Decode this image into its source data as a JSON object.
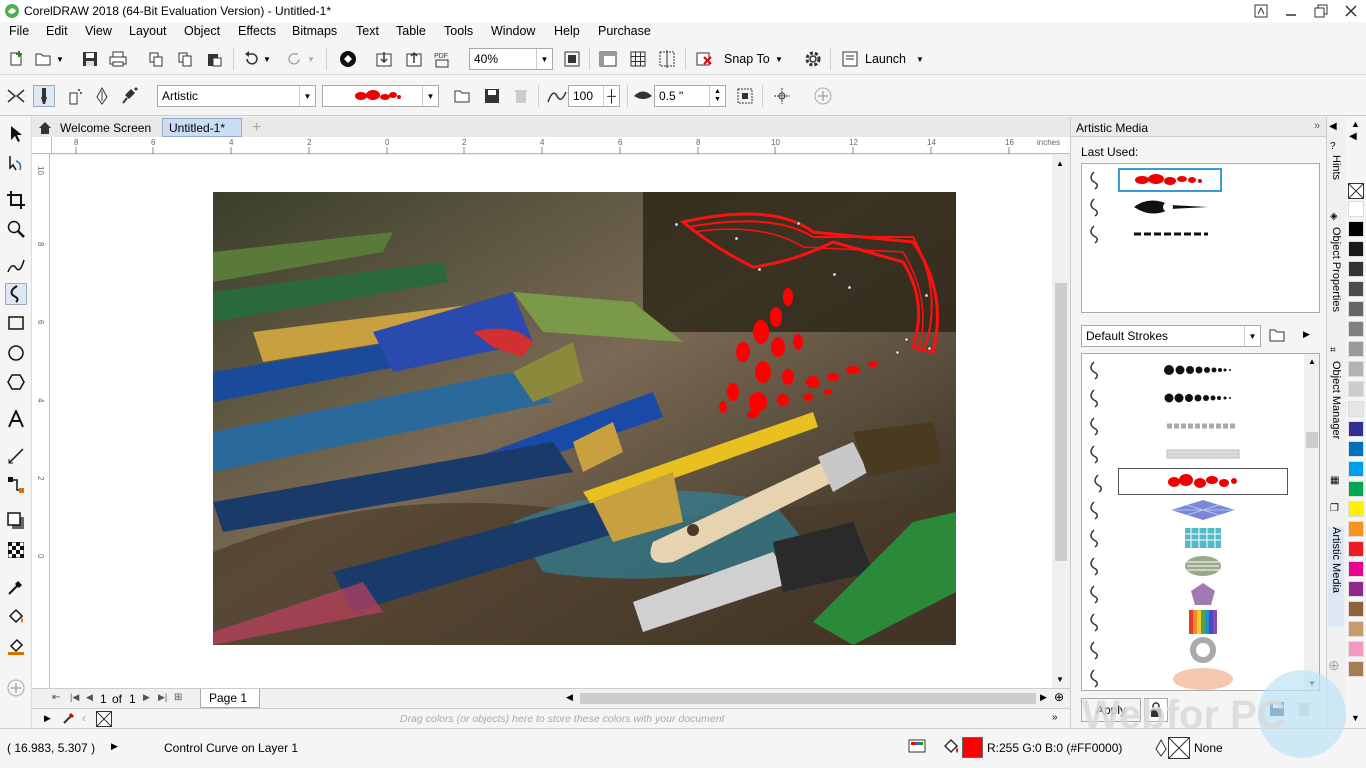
{
  "window": {
    "title": "CorelDRAW 2018 (64-Bit Evaluation Version) - Untitled-1*"
  },
  "menu": [
    "File",
    "Edit",
    "View",
    "Layout",
    "Object",
    "Effects",
    "Bitmaps",
    "Text",
    "Table",
    "Tools",
    "Window",
    "Help",
    "Purchase"
  ],
  "standard_toolbar": {
    "zoom": "40%",
    "snap_to": "Snap To",
    "launch": "Launch"
  },
  "property_bar": {
    "mode": "Artistic",
    "smoothing": "100",
    "width": "0.5 \""
  },
  "doc_tabs": {
    "welcome": "Welcome Screen",
    "doc": "Untitled-1*"
  },
  "ruler": {
    "units": "inches",
    "h_ticks": [
      "8",
      "6",
      "4",
      "2",
      "0",
      "2",
      "4",
      "6",
      "8",
      "10",
      "12",
      "14",
      "16"
    ],
    "v_ticks": [
      "10",
      "8",
      "6",
      "4",
      "2",
      "0"
    ]
  },
  "page_nav": {
    "current": "1",
    "of_label": "of",
    "total": "1",
    "page_tab": "Page 1"
  },
  "color_strip": {
    "hint": "Drag colors (or objects) here to store these colors with your document"
  },
  "status": {
    "coords": "( 16.983, 5.307 )",
    "message": "Control Curve on Layer 1",
    "fill": "R:255 G:0 B:0 (#FF0000)",
    "outline": "None",
    "fill_color": "#FF0000"
  },
  "docker": {
    "title": "Artistic Media",
    "last_used": "Last Used:",
    "category": "Default Strokes",
    "apply": "Apply",
    "side_tabs": [
      "Hints",
      "Object Properties",
      "Object Manager",
      "Artistic Media"
    ]
  },
  "palette": [
    "#ffffff",
    "#000000",
    "#1a1a1a",
    "#333333",
    "#4d4d4d",
    "#666666",
    "#808080",
    "#999999",
    "#b3b3b3",
    "#cccccc",
    "#e6e6e6",
    "#2e3192",
    "#0072bc",
    "#00a0e9",
    "#00a651",
    "#fff200",
    "#f7941d",
    "#ed1c24",
    "#ec008c",
    "#92278f",
    "#8c6239",
    "#c69c6d",
    "#f49ac1",
    "#a67c52"
  ],
  "watermark": {
    "text": "Webfor PC"
  }
}
